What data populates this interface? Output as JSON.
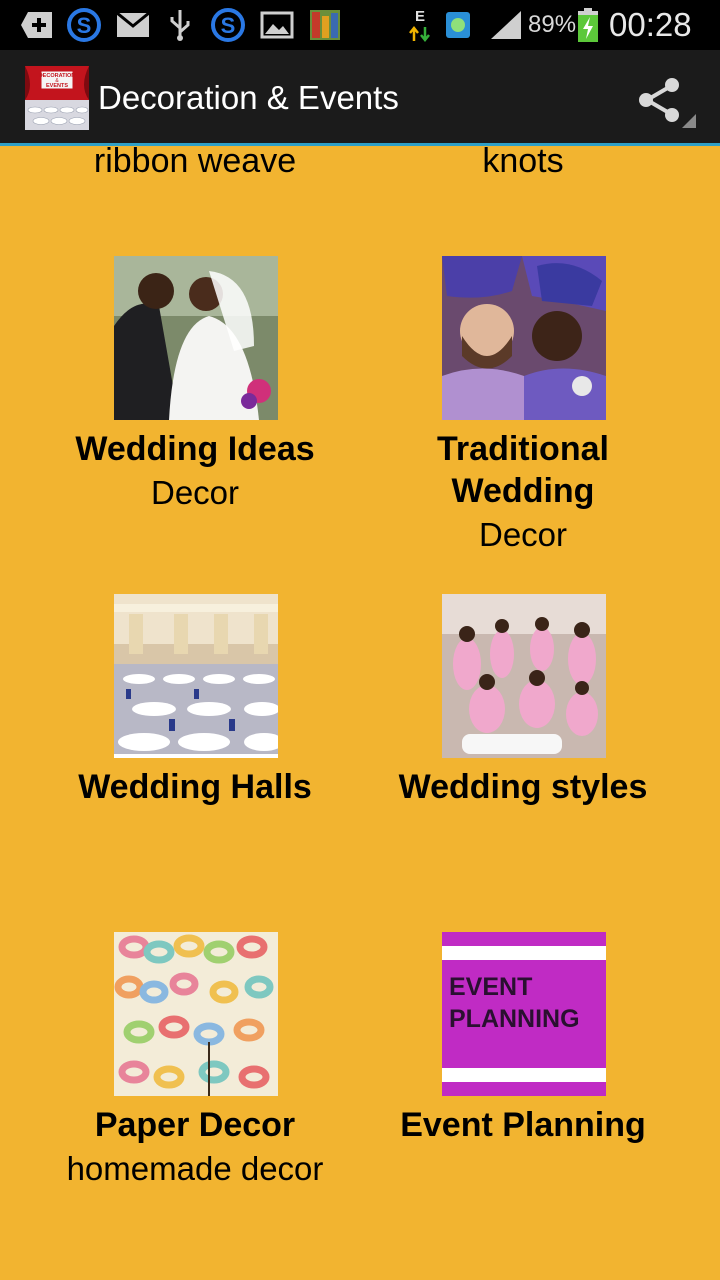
{
  "status_bar": {
    "battery": "89%",
    "time": "00:28",
    "network_type": "E",
    "icons": [
      "add-box-icon",
      "skype-icon",
      "mail-icon",
      "usb-icon",
      "skype-icon",
      "image-icon",
      "app-icon",
      "data-arrows-icon",
      "globe-icon",
      "signal-icon",
      "battery-charging-icon"
    ]
  },
  "action_bar": {
    "title": "Decoration & Events",
    "logo_icon": "decoration-events-logo",
    "share_icon": "share-icon",
    "logo_text": [
      "DECORATION",
      "&",
      "EVENTS"
    ]
  },
  "grid": {
    "partial_top": [
      {
        "title": "ribbon weave"
      },
      {
        "title": "knots"
      }
    ],
    "items": [
      {
        "title": "Wedding Ideas",
        "subtitle": "Decor",
        "image": "wedding-couple-photo"
      },
      {
        "title": "Traditional Wedding",
        "subtitle": "Decor",
        "image": "traditional-wedding-photo"
      },
      {
        "title": "Wedding Halls",
        "subtitle": "",
        "image": "wedding-hall-photo"
      },
      {
        "title": "Wedding styles",
        "subtitle": "",
        "image": "bridesmaids-photo"
      },
      {
        "title": "Paper Decor",
        "subtitle": "homemade decor",
        "image": "paper-chain-photo"
      },
      {
        "title": "Event Planning",
        "subtitle": "",
        "image": "event-planning-graphic",
        "image_text": [
          "EVENT",
          "PLANNING"
        ]
      }
    ]
  },
  "colors": {
    "background": "#f2b430",
    "action_bar": "#1b1b1b",
    "accent": "#2e9fc6",
    "event_planning_purple": "#c02bc4"
  }
}
